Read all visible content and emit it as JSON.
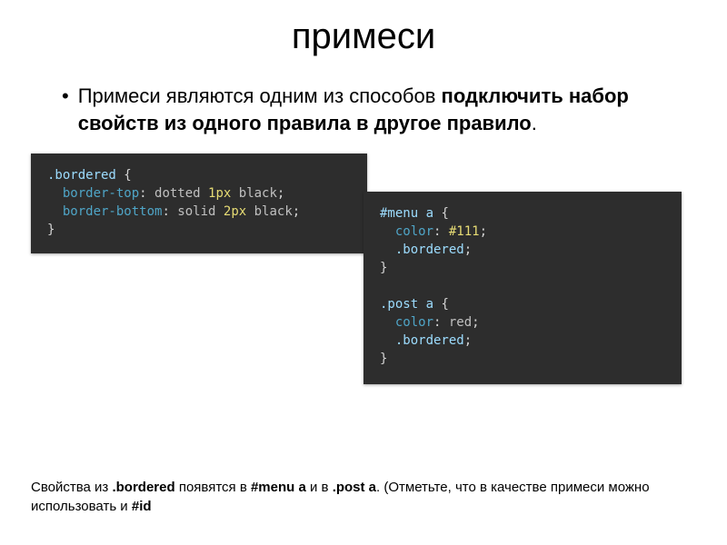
{
  "title": "примеси",
  "bullet": {
    "lead": "Примеси являются одним из способов ",
    "bold": "подключить набор свойств из одного правила в другое правило",
    "tail": "."
  },
  "code1": {
    "l1_sel": ".bordered",
    "l1_brace": " {",
    "l2_prop": "  border-top",
    "l2_sep": ": ",
    "l2_v1": "dotted",
    "l2_sp1": " ",
    "l2_v2": "1px",
    "l2_sp2": " ",
    "l2_v3": "black",
    "l2_end": ";",
    "l3_prop": "  border-bottom",
    "l3_sep": ": ",
    "l3_v1": "solid",
    "l3_sp1": " ",
    "l3_v2": "2px",
    "l3_sp2": " ",
    "l3_v3": "black",
    "l3_end": ";",
    "l4_brace": "}"
  },
  "code2": {
    "a1_sel": "#menu a",
    "a1_brace": " {",
    "a2_prop": "  color",
    "a2_sep": ": ",
    "a2_val": "#111",
    "a2_end": ";",
    "a3_mix": "  .bordered",
    "a3_end": ";",
    "a4_brace": "}",
    "blank": "",
    "b1_sel": ".post a",
    "b1_brace": " {",
    "b2_prop": "  color",
    "b2_sep": ": ",
    "b2_val": "red",
    "b2_end": ";",
    "b3_mix": "  .bordered",
    "b3_end": ";",
    "b4_brace": "}"
  },
  "footnote": {
    "t1": "Свойства из ",
    "b1": ".bordered",
    "t2": " появятся в ",
    "b2": "#menu a",
    "t3": " и в ",
    "b3": ".post a",
    "t4": ". (Отметьте, что в качестве примеси можно использовать и ",
    "b4": "#id"
  }
}
